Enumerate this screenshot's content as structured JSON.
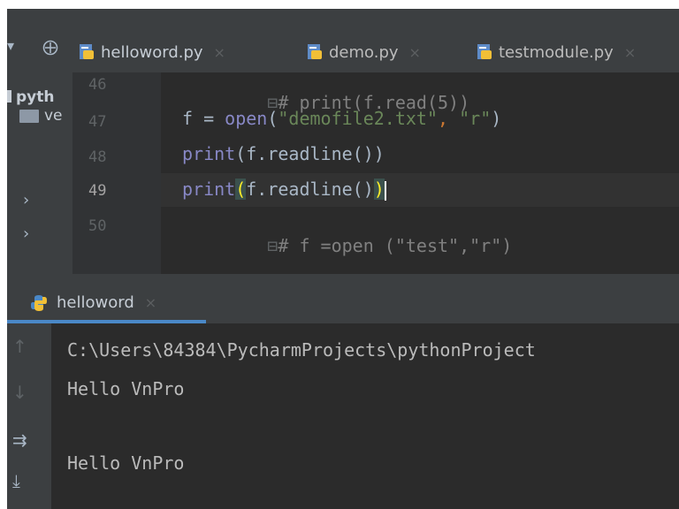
{
  "tabs": [
    {
      "label": "helloword.py",
      "active": true
    },
    {
      "label": "demo.py",
      "active": false
    },
    {
      "label": "testmodule.py",
      "active": false
    }
  ],
  "project": {
    "root_label": "pyth",
    "folder_label": "ve"
  },
  "gutter": {
    "lines": [
      "46",
      "47",
      "48",
      "49",
      "50"
    ],
    "current_line": "49"
  },
  "code": {
    "line46": "# print(f.read(5))",
    "line47_var": "f = ",
    "line47_fn": "open",
    "line47_open": "(",
    "line47_arg1": "\"demofile2.txt\"",
    "line47_comma": ", ",
    "line47_arg2": "\"r\"",
    "line47_close": ")",
    "line48_fn": "print",
    "line48_rest": "(f.readline())",
    "line49_fn": "print",
    "line49_open": "(",
    "line49_mid": "f.readline()",
    "line49_close": ")",
    "line50": "# f =open (\"test\",\"r\")"
  },
  "run_panel": {
    "tab_label": "helloword"
  },
  "console": {
    "lines": [
      "C:\\Users\\84384\\PycharmProjects\\pythonProject",
      "Hello VnPro",
      "",
      "Hello VnPro"
    ]
  },
  "colors": {
    "background": "#2b2b2b",
    "panel": "#3c3f41",
    "accent": "#4a88c7",
    "string": "#6a8759",
    "builtin": "#8888c6",
    "comment": "#808080"
  }
}
